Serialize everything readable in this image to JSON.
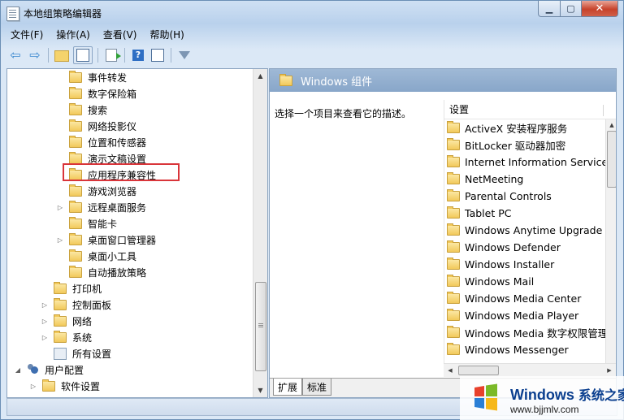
{
  "window": {
    "title": "本地组策略编辑器",
    "min_label": "▁",
    "max_label": "▢",
    "close_label": "✕"
  },
  "menu": [
    "文件(F)",
    "操作(A)",
    "查看(V)",
    "帮助(H)"
  ],
  "toolbar": {
    "icons": [
      "back-arrow-icon",
      "forward-arrow-icon",
      "up-folder-icon",
      "show-hide-tree-icon",
      "export-list-icon",
      "help-icon",
      "properties-icon",
      "filter-icon"
    ],
    "back_glyph": "⇦",
    "forward_glyph": "⇨",
    "help_glyph": "?"
  },
  "tree": {
    "items": [
      {
        "label": "事件转发",
        "expander": ""
      },
      {
        "label": "数字保险箱",
        "expander": ""
      },
      {
        "label": "搜索",
        "expander": ""
      },
      {
        "label": "网络投影仪",
        "expander": ""
      },
      {
        "label": "位置和传感器",
        "expander": ""
      },
      {
        "label": "演示文稿设置",
        "expander": ""
      },
      {
        "label": "应用程序兼容性",
        "expander": ""
      },
      {
        "label": "游戏浏览器",
        "expander": ""
      },
      {
        "label": "远程桌面服务",
        "expander": "▷"
      },
      {
        "label": "智能卡",
        "expander": ""
      },
      {
        "label": "桌面窗口管理器",
        "expander": "▷"
      },
      {
        "label": "桌面小工具",
        "expander": ""
      },
      {
        "label": "自动播放策略",
        "expander": ""
      },
      {
        "label": "打印机",
        "expander": ""
      },
      {
        "label": "控制面板",
        "expander": "▷"
      },
      {
        "label": "网络",
        "expander": "▷"
      },
      {
        "label": "系统",
        "expander": "▷"
      },
      {
        "label": "所有设置",
        "expander": ""
      },
      {
        "label": "用户配置",
        "expander": "◢"
      },
      {
        "label": "软件设置",
        "expander": "▷"
      }
    ],
    "highlighted": "应用程序兼容性"
  },
  "right_pane": {
    "header_title": "Windows 组件",
    "description": "选择一个项目来查看它的描述。",
    "column_header": "设置",
    "items": [
      "ActiveX 安装程序服务",
      "BitLocker 驱动器加密",
      "Internet Information Services",
      "NetMeeting",
      "Parental Controls",
      "Tablet PC",
      "Windows Anytime Upgrade",
      "Windows Defender",
      "Windows Installer",
      "Windows Mail",
      "Windows Media Center",
      "Windows Media Player",
      "Windows Media 数字权限管理",
      "Windows Messenger"
    ]
  },
  "tabs": {
    "extended": "扩展",
    "standard": "标准"
  },
  "watermark": {
    "brand": "Windows",
    "brand_zh": "系统之家",
    "url": "www.bjjmlv.com"
  },
  "colors": {
    "highlight_border": "#d9353a",
    "header_bg": "#88a6c9",
    "watermark_blue": "#0b3f8f"
  }
}
